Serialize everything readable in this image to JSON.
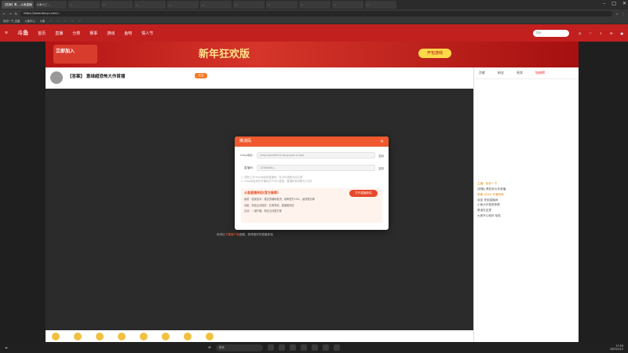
{
  "browser": {
    "tabs": [
      "【答案】黑..._斗鱼直播",
      "斗鱼小工...",
      "...",
      "...",
      "...",
      "...",
      "...",
      "...",
      "...",
      "...",
      "...",
      "..."
    ],
    "url": "https://www.douyu.com/...",
    "bookmarks": [
      "自动一下_百度",
      "斗鱼中心",
      "斗鱼",
      "...",
      "...",
      "...",
      "...",
      "..."
    ]
  },
  "site": {
    "logo": "斗鱼",
    "nav": [
      "首页",
      "直播",
      "分类",
      "赛事",
      "游戏",
      "鱼吧",
      "情人节"
    ],
    "search_placeholder": "搜索"
  },
  "banner": {
    "join_text": "立即加入",
    "headline": "新年狂欢版",
    "button": "开包游戏"
  },
  "room": {
    "title": "【答案】 意绿超恐怖大作首播",
    "follow": "关注"
  },
  "chat": {
    "tabs": [
      "贡献",
      "粉丝",
      "贵宾",
      "钻粉榜"
    ],
    "messages": [
      "主播：找你一下",
      "[房管] 黑吃你大作首播",
      "恭喜 XXXX 开通贵族",
      "欢迎 来到直播间",
      "小熊大作很恐怖啊",
      "是谁在这里",
      "大家开心就好 哈哈"
    ]
  },
  "dialog": {
    "title": "推流码",
    "rtmp_label": "rtmp地址:",
    "rtmp_value": "rtmp://sendfive1.douyucdn.cn/live",
    "code_label": "直播码:",
    "code_value": "12506ddc/...",
    "copy": "复制",
    "hint1": "1. 复制上方rtmp地址和直播码，在OBS里面对应位置",
    "hint2": "2. rtmp地址仅在开播情况下可以使用，直播码有效期为1分钟",
    "promo_title": "斗鱼直播伴侣(官方推荐)",
    "promo_badge": "官方推荐",
    "promo_button": "打开直播伴侣",
    "promo_lines": [
      "画质：独家技术，稳定的编码推流，帧率提升20%，画质更清晰",
      "功能：特色互动插件、礼物特效，直播更精彩",
      "互动：一键开播，粉丝互动更方便"
    ]
  },
  "player_note": {
    "prefix": "也可以",
    "link": "下载客户端",
    "suffix": "观看，获得更好的观看体验"
  },
  "taskbar": {
    "search": "搜索",
    "time": "17:59",
    "date": "2023/1/12"
  }
}
